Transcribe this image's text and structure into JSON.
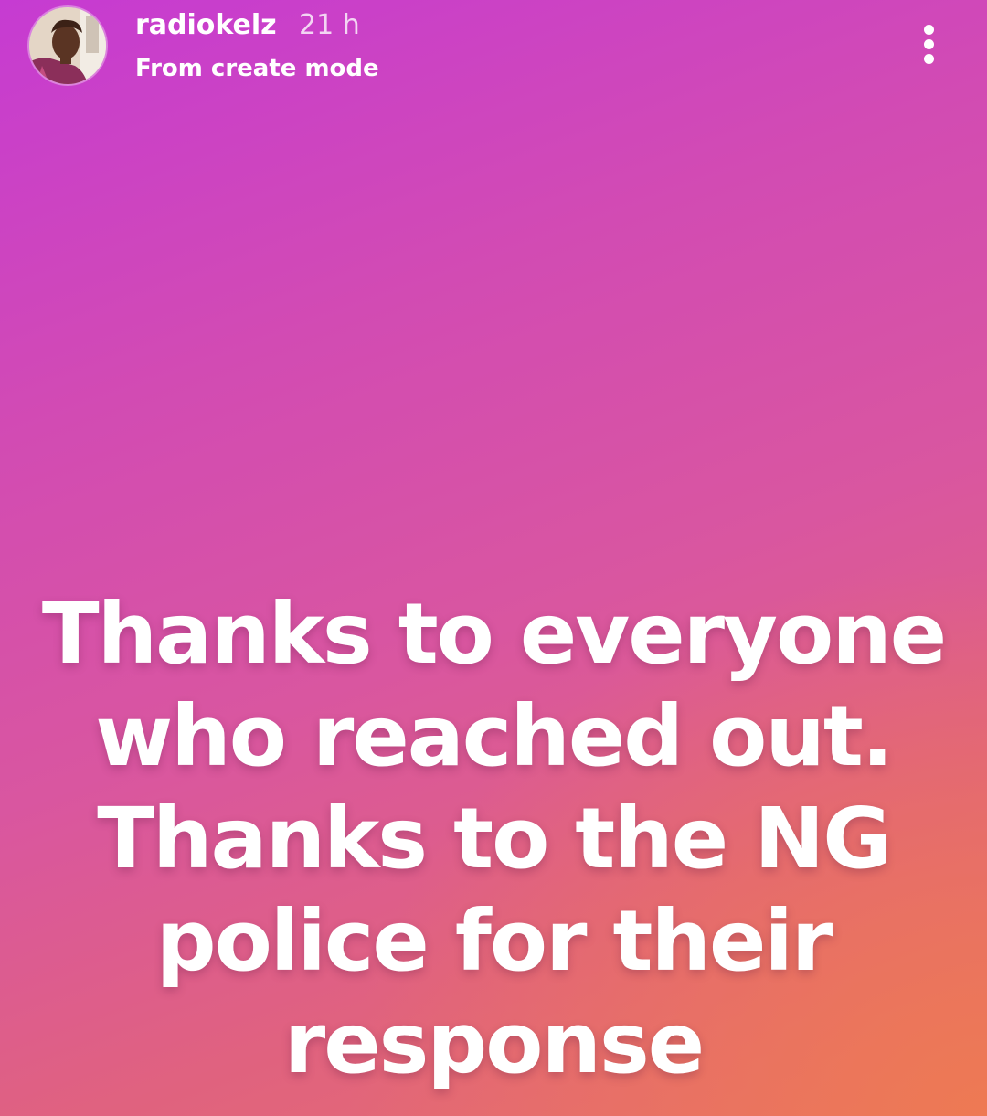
{
  "header": {
    "username": "radiokelz",
    "time": "21 h",
    "subtitle": "From create mode"
  },
  "icons": {
    "avatar": "profile-photo",
    "more": "more-vertical-icon"
  },
  "story": {
    "lines": [
      "Thanks to everyone",
      "who reached out.",
      "Thanks to the NG",
      "police for their",
      "response"
    ]
  },
  "colors": {
    "gradient_top_left": "#c63bd2",
    "gradient_bottom_right": "#ee7a52",
    "text": "#ffffff"
  }
}
